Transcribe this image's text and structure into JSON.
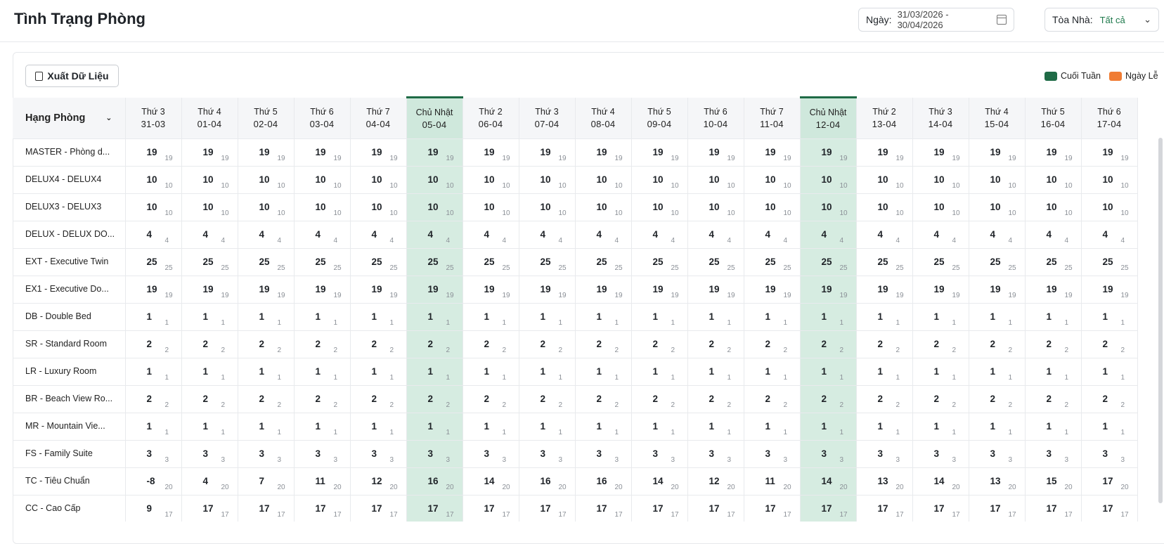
{
  "header": {
    "title": "Tình Trạng Phòng",
    "date_label": "Ngày:",
    "date_value": "31/03/2026 - 30/04/2026",
    "building_label": "Tòa Nhà:",
    "building_value": "Tất cả"
  },
  "toolbar": {
    "export_label": "Xuất Dữ Liệu"
  },
  "legend": [
    {
      "label": "Cuối Tuần",
      "color": "#1f6b46"
    },
    {
      "label": "Ngày Lễ",
      "color": "#f07c33"
    }
  ],
  "table": {
    "room_header": "Hạng Phòng",
    "days": [
      {
        "dow": "Thứ 3",
        "date": "31-03",
        "weekend": false
      },
      {
        "dow": "Thứ 4",
        "date": "01-04",
        "weekend": false
      },
      {
        "dow": "Thứ 5",
        "date": "02-04",
        "weekend": false
      },
      {
        "dow": "Thứ 6",
        "date": "03-04",
        "weekend": false
      },
      {
        "dow": "Thứ 7",
        "date": "04-04",
        "weekend": false
      },
      {
        "dow": "Chủ Nhật",
        "date": "05-04",
        "weekend": true
      },
      {
        "dow": "Thứ 2",
        "date": "06-04",
        "weekend": false
      },
      {
        "dow": "Thứ 3",
        "date": "07-04",
        "weekend": false
      },
      {
        "dow": "Thứ 4",
        "date": "08-04",
        "weekend": false
      },
      {
        "dow": "Thứ 5",
        "date": "09-04",
        "weekend": false
      },
      {
        "dow": "Thứ 6",
        "date": "10-04",
        "weekend": false
      },
      {
        "dow": "Thứ 7",
        "date": "11-04",
        "weekend": false
      },
      {
        "dow": "Chủ Nhật",
        "date": "12-04",
        "weekend": true
      },
      {
        "dow": "Thứ 2",
        "date": "13-04",
        "weekend": false
      },
      {
        "dow": "Thứ 3",
        "date": "14-04",
        "weekend": false
      },
      {
        "dow": "Thứ 4",
        "date": "15-04",
        "weekend": false
      },
      {
        "dow": "Thứ 5",
        "date": "16-04",
        "weekend": false
      },
      {
        "dow": "Thứ 6",
        "date": "17-04",
        "weekend": false
      }
    ],
    "rows": [
      {
        "name": "MASTER - Phòng d...",
        "avail": [
          19,
          19,
          19,
          19,
          19,
          19,
          19,
          19,
          19,
          19,
          19,
          19,
          19,
          19,
          19,
          19,
          19,
          19
        ],
        "total": [
          19,
          19,
          19,
          19,
          19,
          19,
          19,
          19,
          19,
          19,
          19,
          19,
          19,
          19,
          19,
          19,
          19,
          19
        ]
      },
      {
        "name": "DELUX4 - DELUX4",
        "avail": [
          10,
          10,
          10,
          10,
          10,
          10,
          10,
          10,
          10,
          10,
          10,
          10,
          10,
          10,
          10,
          10,
          10,
          10
        ],
        "total": [
          10,
          10,
          10,
          10,
          10,
          10,
          10,
          10,
          10,
          10,
          10,
          10,
          10,
          10,
          10,
          10,
          10,
          10
        ]
      },
      {
        "name": "DELUX3 - DELUX3",
        "avail": [
          10,
          10,
          10,
          10,
          10,
          10,
          10,
          10,
          10,
          10,
          10,
          10,
          10,
          10,
          10,
          10,
          10,
          10
        ],
        "total": [
          10,
          10,
          10,
          10,
          10,
          10,
          10,
          10,
          10,
          10,
          10,
          10,
          10,
          10,
          10,
          10,
          10,
          10
        ]
      },
      {
        "name": "DELUX - DELUX DO...",
        "avail": [
          4,
          4,
          4,
          4,
          4,
          4,
          4,
          4,
          4,
          4,
          4,
          4,
          4,
          4,
          4,
          4,
          4,
          4
        ],
        "total": [
          4,
          4,
          4,
          4,
          4,
          4,
          4,
          4,
          4,
          4,
          4,
          4,
          4,
          4,
          4,
          4,
          4,
          4
        ]
      },
      {
        "name": "EXT - Executive Twin",
        "avail": [
          25,
          25,
          25,
          25,
          25,
          25,
          25,
          25,
          25,
          25,
          25,
          25,
          25,
          25,
          25,
          25,
          25,
          25
        ],
        "total": [
          25,
          25,
          25,
          25,
          25,
          25,
          25,
          25,
          25,
          25,
          25,
          25,
          25,
          25,
          25,
          25,
          25,
          25
        ]
      },
      {
        "name": "EX1 - Executive Do...",
        "avail": [
          19,
          19,
          19,
          19,
          19,
          19,
          19,
          19,
          19,
          19,
          19,
          19,
          19,
          19,
          19,
          19,
          19,
          19
        ],
        "total": [
          19,
          19,
          19,
          19,
          19,
          19,
          19,
          19,
          19,
          19,
          19,
          19,
          19,
          19,
          19,
          19,
          19,
          19
        ]
      },
      {
        "name": "DB - Double Bed",
        "avail": [
          1,
          1,
          1,
          1,
          1,
          1,
          1,
          1,
          1,
          1,
          1,
          1,
          1,
          1,
          1,
          1,
          1,
          1
        ],
        "total": [
          1,
          1,
          1,
          1,
          1,
          1,
          1,
          1,
          1,
          1,
          1,
          1,
          1,
          1,
          1,
          1,
          1,
          1
        ]
      },
      {
        "name": "SR - Standard Room",
        "avail": [
          2,
          2,
          2,
          2,
          2,
          2,
          2,
          2,
          2,
          2,
          2,
          2,
          2,
          2,
          2,
          2,
          2,
          2
        ],
        "total": [
          2,
          2,
          2,
          2,
          2,
          2,
          2,
          2,
          2,
          2,
          2,
          2,
          2,
          2,
          2,
          2,
          2,
          2
        ]
      },
      {
        "name": "LR - Luxury Room",
        "avail": [
          1,
          1,
          1,
          1,
          1,
          1,
          1,
          1,
          1,
          1,
          1,
          1,
          1,
          1,
          1,
          1,
          1,
          1
        ],
        "total": [
          1,
          1,
          1,
          1,
          1,
          1,
          1,
          1,
          1,
          1,
          1,
          1,
          1,
          1,
          1,
          1,
          1,
          1
        ]
      },
      {
        "name": "BR - Beach View Ro...",
        "avail": [
          2,
          2,
          2,
          2,
          2,
          2,
          2,
          2,
          2,
          2,
          2,
          2,
          2,
          2,
          2,
          2,
          2,
          2
        ],
        "total": [
          2,
          2,
          2,
          2,
          2,
          2,
          2,
          2,
          2,
          2,
          2,
          2,
          2,
          2,
          2,
          2,
          2,
          2
        ]
      },
      {
        "name": "MR - Mountain Vie...",
        "avail": [
          1,
          1,
          1,
          1,
          1,
          1,
          1,
          1,
          1,
          1,
          1,
          1,
          1,
          1,
          1,
          1,
          1,
          1
        ],
        "total": [
          1,
          1,
          1,
          1,
          1,
          1,
          1,
          1,
          1,
          1,
          1,
          1,
          1,
          1,
          1,
          1,
          1,
          1
        ]
      },
      {
        "name": "FS - Family Suite",
        "avail": [
          3,
          3,
          3,
          3,
          3,
          3,
          3,
          3,
          3,
          3,
          3,
          3,
          3,
          3,
          3,
          3,
          3,
          3
        ],
        "total": [
          3,
          3,
          3,
          3,
          3,
          3,
          3,
          3,
          3,
          3,
          3,
          3,
          3,
          3,
          3,
          3,
          3,
          3
        ]
      },
      {
        "name": "TC - Tiêu Chuẩn",
        "avail": [
          -8,
          4,
          7,
          11,
          12,
          16,
          14,
          16,
          16,
          14,
          12,
          11,
          14,
          13,
          14,
          13,
          15,
          17
        ],
        "total": [
          20,
          20,
          20,
          20,
          20,
          20,
          20,
          20,
          20,
          20,
          20,
          20,
          20,
          20,
          20,
          20,
          20,
          20
        ]
      },
      {
        "name": "CC - Cao Cấp",
        "avail": [
          9,
          17,
          17,
          17,
          17,
          17,
          17,
          17,
          17,
          17,
          17,
          17,
          17,
          17,
          17,
          17,
          17,
          17
        ],
        "total": [
          17,
          17,
          17,
          17,
          17,
          17,
          17,
          17,
          17,
          17,
          17,
          17,
          17,
          17,
          17,
          17,
          17,
          17
        ]
      }
    ]
  }
}
